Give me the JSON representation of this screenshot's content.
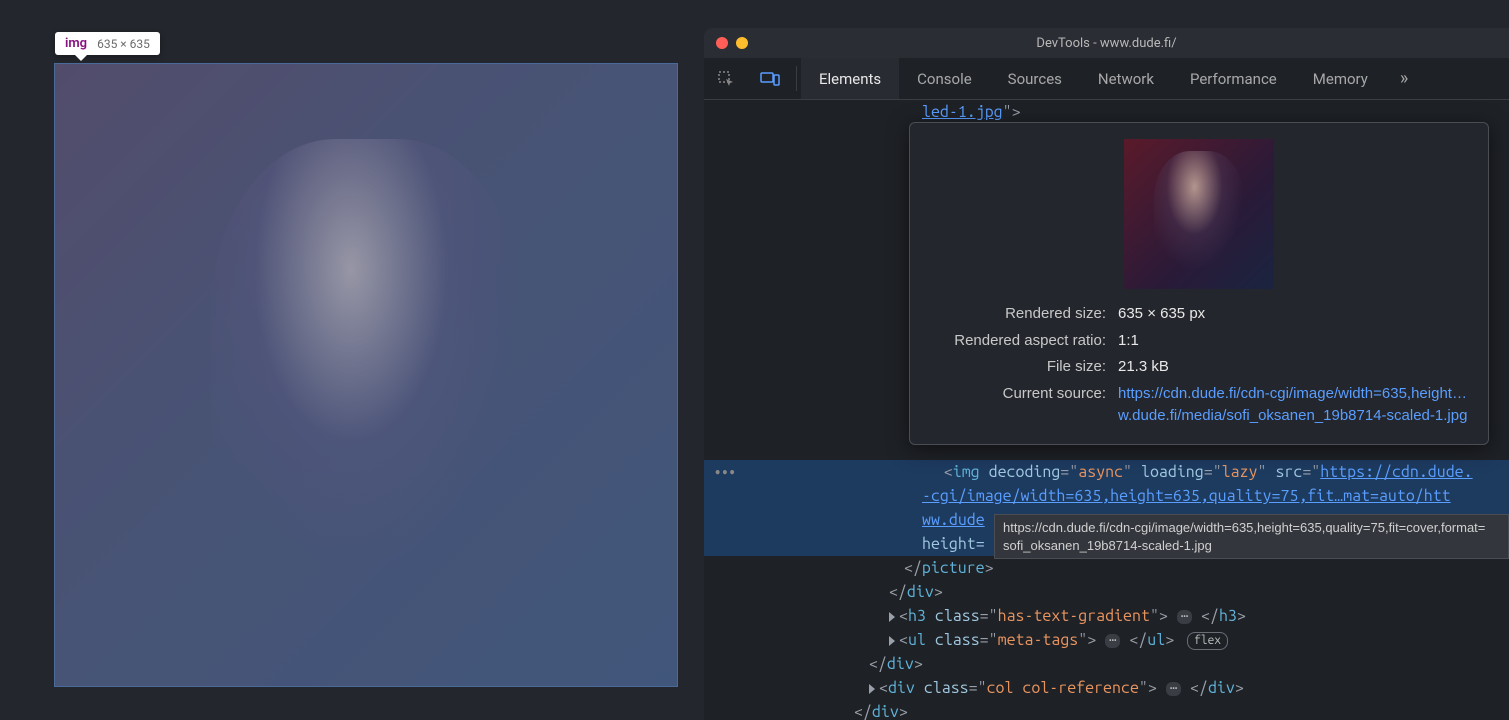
{
  "inspector_tooltip": {
    "tag": "img",
    "dimensions": "635 × 635"
  },
  "devtools": {
    "window_title": "DevTools - www.dude.fi/",
    "tabs": [
      "Elements",
      "Console",
      "Sources",
      "Network",
      "Performance",
      "Memory"
    ],
    "active_tab": "Elements"
  },
  "hover_card": {
    "labels": {
      "rendered_size": "Rendered size:",
      "aspect_ratio": "Rendered aspect ratio:",
      "file_size": "File size:",
      "current_source": "Current source:"
    },
    "values": {
      "rendered_size": "635 × 635 px",
      "aspect_ratio": "1:1",
      "file_size": "21.3 kB",
      "current_source": "https://cdn.dude.fi/cdn-cgi/image/width=635,height…w.dude.fi/media/sofi_oksanen_19b8714-scaled-1.jpg"
    }
  },
  "code": {
    "line_top": "led-1.jpg",
    "img_attrs": {
      "decoding": "async",
      "loading": "lazy",
      "src_prefix": "https://cdn.dude.",
      "src_cont1": "-cgi/image/width=635,height=635,quality=75,fit…mat=auto/htt",
      "src_cont2": "ww.dude"
    },
    "height_label": "height=",
    "picture_close": "</picture>",
    "div_close": "</div>",
    "h3_class": "has-text-gradient",
    "ul_class": "meta-tags",
    "flex_badge": "flex",
    "col_ref_class": "col col-reference"
  },
  "url_tooltip": "https://cdn.dude.fi/cdn-cgi/image/width=635,height=635,quality=75,fit=cover,format=\nsofi_oksanen_19b8714-scaled-1.jpg"
}
